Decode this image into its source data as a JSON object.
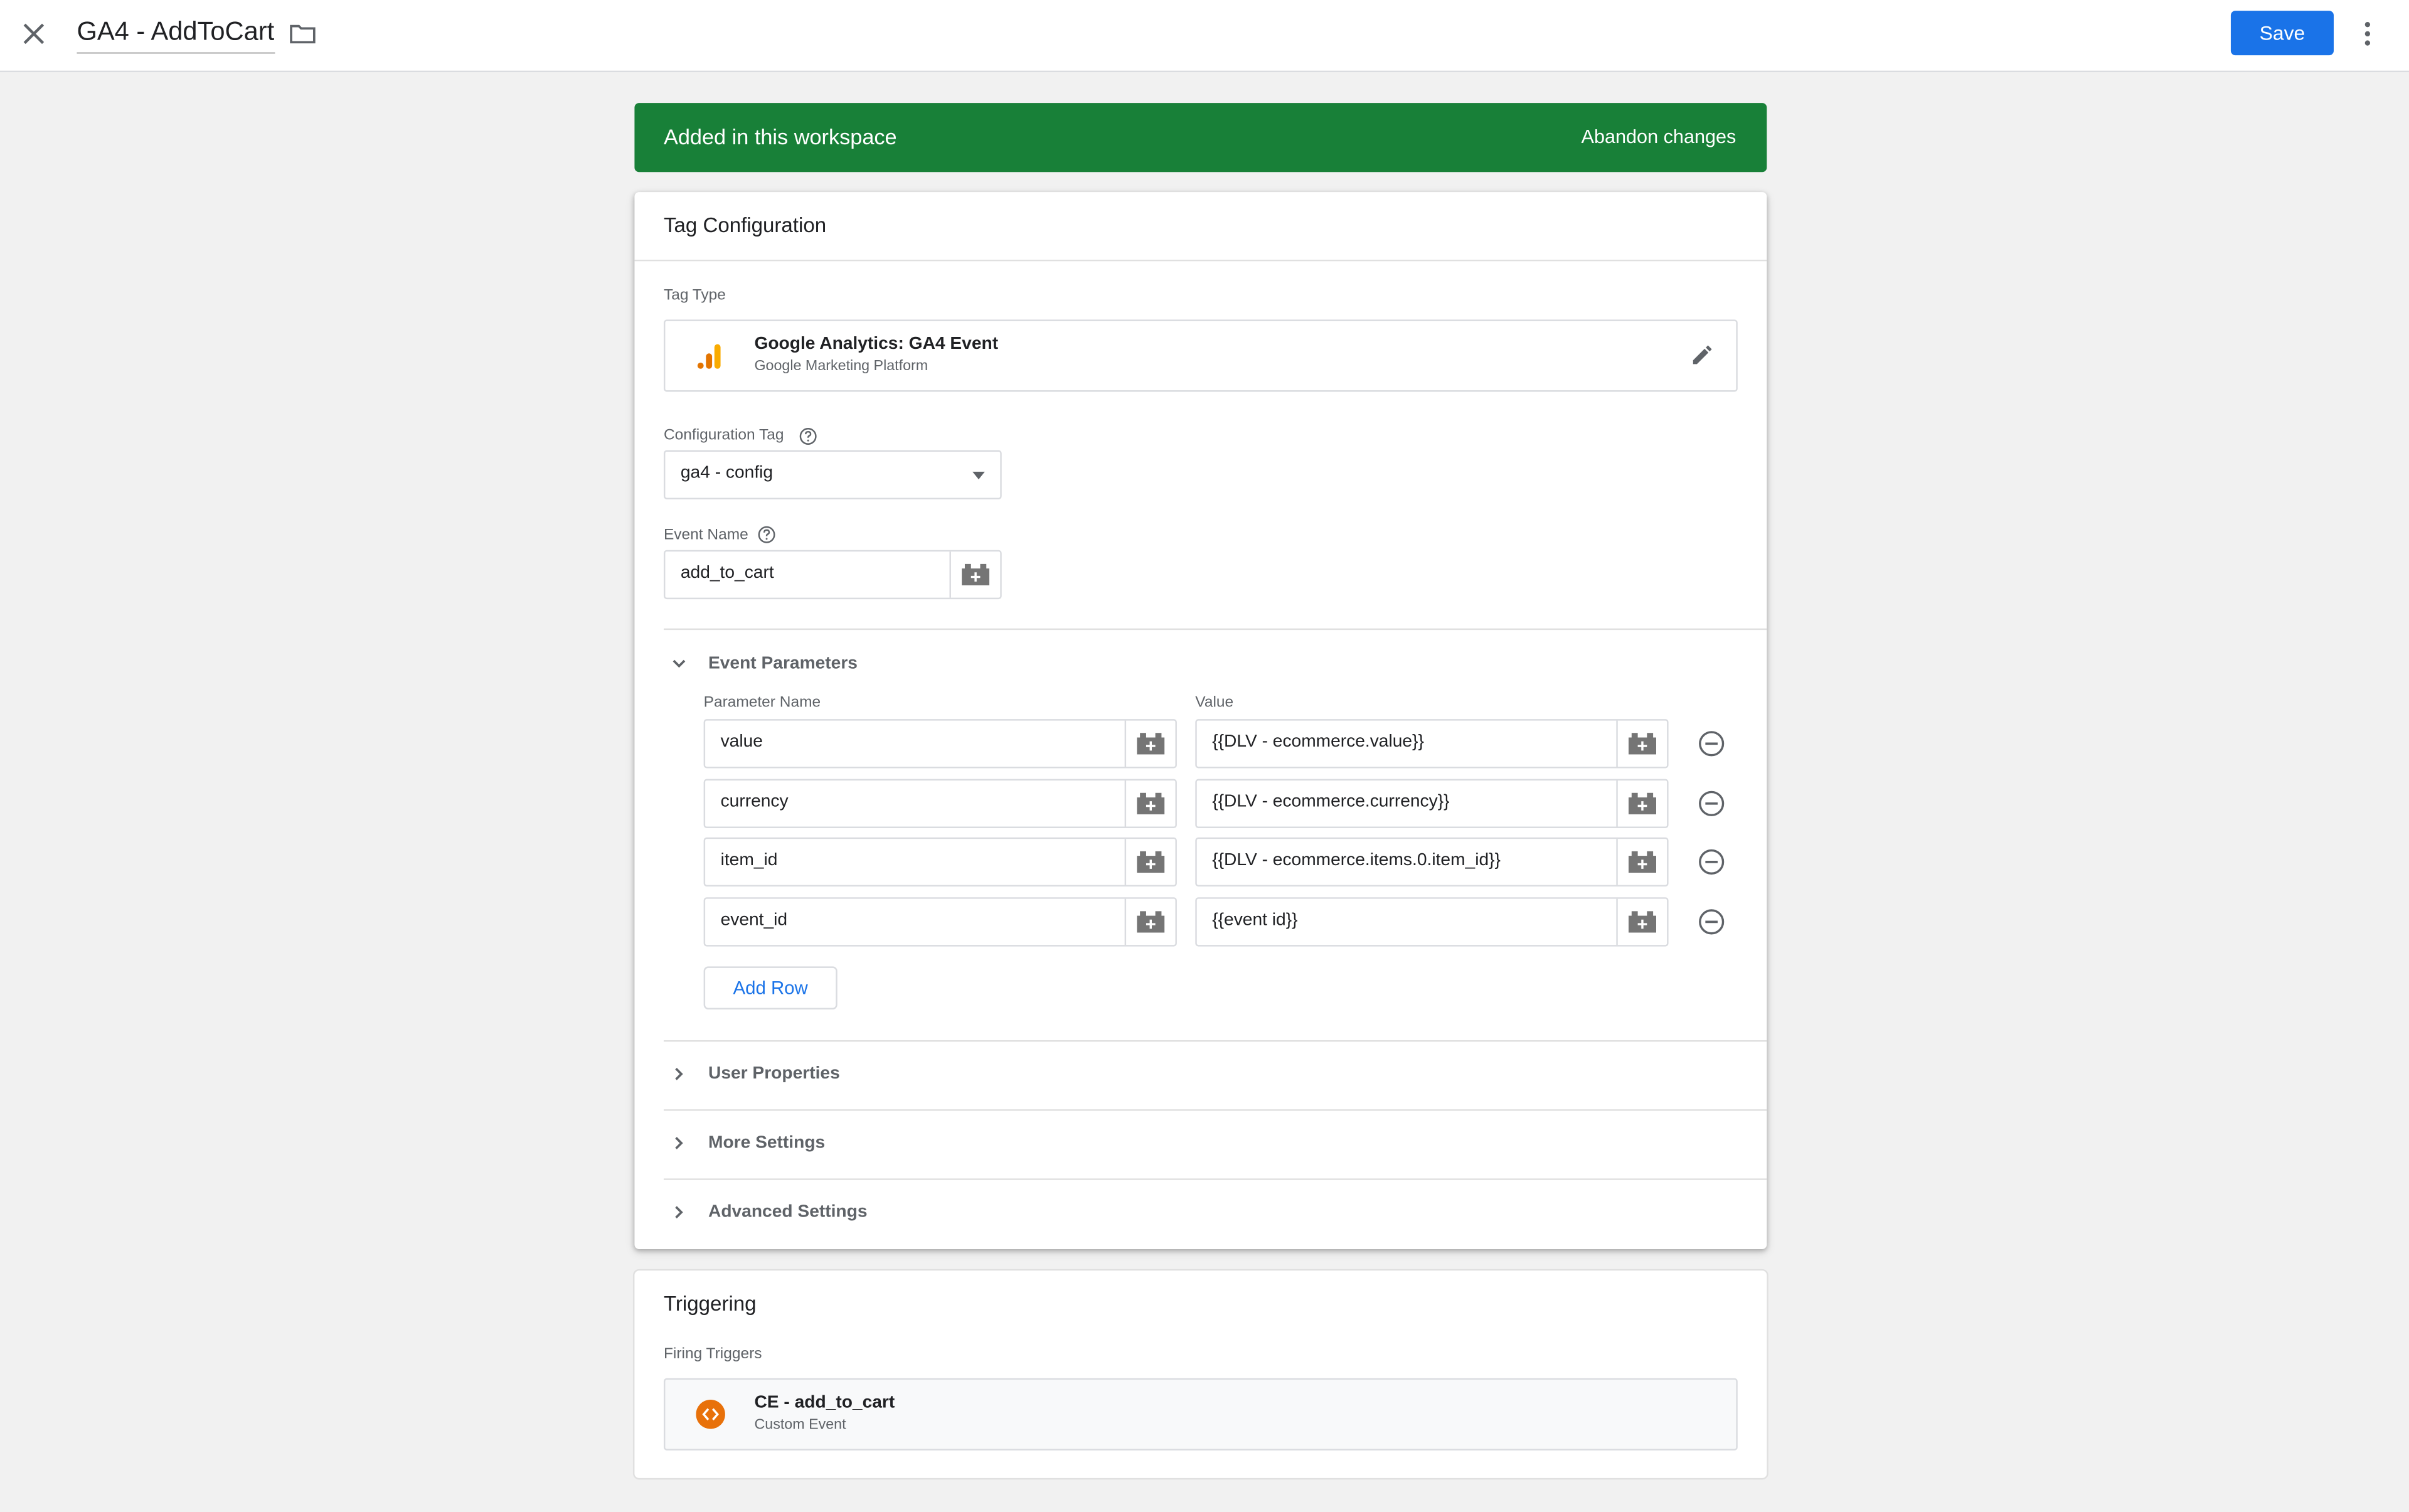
{
  "header": {
    "title": "GA4 - AddToCart",
    "save_label": "Save"
  },
  "banner": {
    "text": "Added in this workspace",
    "action": "Abandon changes",
    "color": "#188038"
  },
  "tag_configuration": {
    "title": "Tag Configuration",
    "tag_type_label": "Tag Type",
    "tag_type": {
      "name": "Google Analytics: GA4 Event",
      "subtitle": "Google Marketing Platform",
      "icon": "ga-bar-chart-icon"
    },
    "config_tag_label": "Configuration Tag",
    "config_tag_value": "ga4 - config",
    "event_name_label": "Event Name",
    "event_name_value": "add_to_cart",
    "event_parameters": {
      "title": "Event Parameters",
      "param_name_header": "Parameter Name",
      "value_header": "Value",
      "rows": [
        {
          "name": "value",
          "value": "{{DLV - ecommerce.value}}"
        },
        {
          "name": "currency",
          "value": "{{DLV - ecommerce.currency}}"
        },
        {
          "name": "item_id",
          "value": "{{DLV - ecommerce.items.0.item_id}}"
        },
        {
          "name": "event_id",
          "value": "{{event id}}"
        }
      ],
      "add_row_label": "Add Row"
    },
    "collapsed_sections": [
      "User Properties",
      "More Settings",
      "Advanced Settings"
    ]
  },
  "triggering": {
    "title": "Triggering",
    "firing_label": "Firing Triggers",
    "trigger": {
      "name": "CE - add_to_cart",
      "subtitle": "Custom Event",
      "icon": "custom-event-icon",
      "color": "#e8710a"
    }
  },
  "colors": {
    "accent": "#1a73e8",
    "ga_orange": "#f9ab00"
  }
}
